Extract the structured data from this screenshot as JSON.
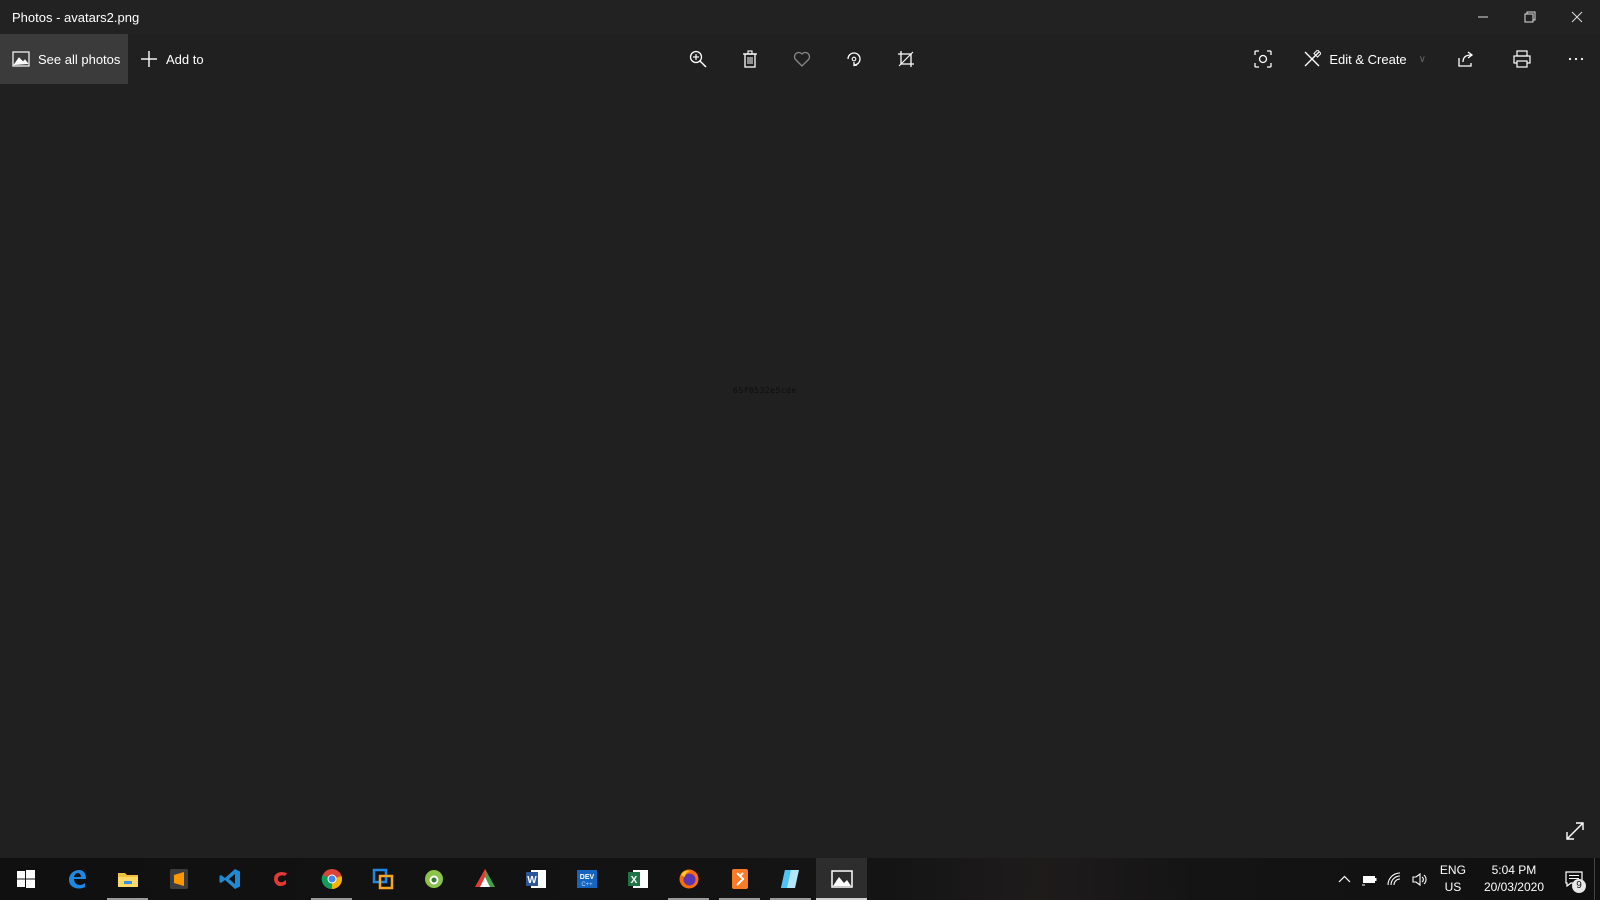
{
  "window": {
    "title": "Photos - avatars2.png"
  },
  "toolbar": {
    "see_all_photos": "See all photos",
    "add_to": "Add to",
    "edit_create": "Edit & Create"
  },
  "canvas": {
    "caption": "65f0532e5cde"
  },
  "taskbar": {
    "apps": [
      {
        "name": "start",
        "icon": "windows-logo-icon"
      },
      {
        "name": "edge",
        "icon": "edge-icon"
      },
      {
        "name": "file-explorer",
        "icon": "folder-icon",
        "running": true
      },
      {
        "name": "sublime-text",
        "icon": "sublime-icon"
      },
      {
        "name": "vscode",
        "icon": "vscode-icon"
      },
      {
        "name": "garena",
        "icon": "garena-icon"
      },
      {
        "name": "chrome",
        "icon": "chrome-icon",
        "running": true
      },
      {
        "name": "virtualbox",
        "icon": "virtualbox-icon"
      },
      {
        "name": "app-green",
        "icon": "green-circle-icon"
      },
      {
        "name": "app-colorful",
        "icon": "colorful-icon"
      },
      {
        "name": "word",
        "icon": "word-icon"
      },
      {
        "name": "devc",
        "icon": "devc-icon"
      },
      {
        "name": "excel",
        "icon": "excel-icon"
      },
      {
        "name": "firefox",
        "icon": "firefox-icon",
        "running": true
      },
      {
        "name": "xampp",
        "icon": "xampp-icon",
        "running": true
      },
      {
        "name": "notes",
        "icon": "notes-icon",
        "running": true
      },
      {
        "name": "photos",
        "icon": "photos-icon",
        "active": true
      }
    ],
    "language": {
      "line1": "ENG",
      "line2": "US"
    },
    "clock": {
      "time": "5:04 PM",
      "date": "20/03/2020"
    },
    "notification_count": "9"
  },
  "colors": {
    "background": "#202020",
    "selected_toolbar": "#3b3b3b",
    "taskbar": "#121212"
  }
}
